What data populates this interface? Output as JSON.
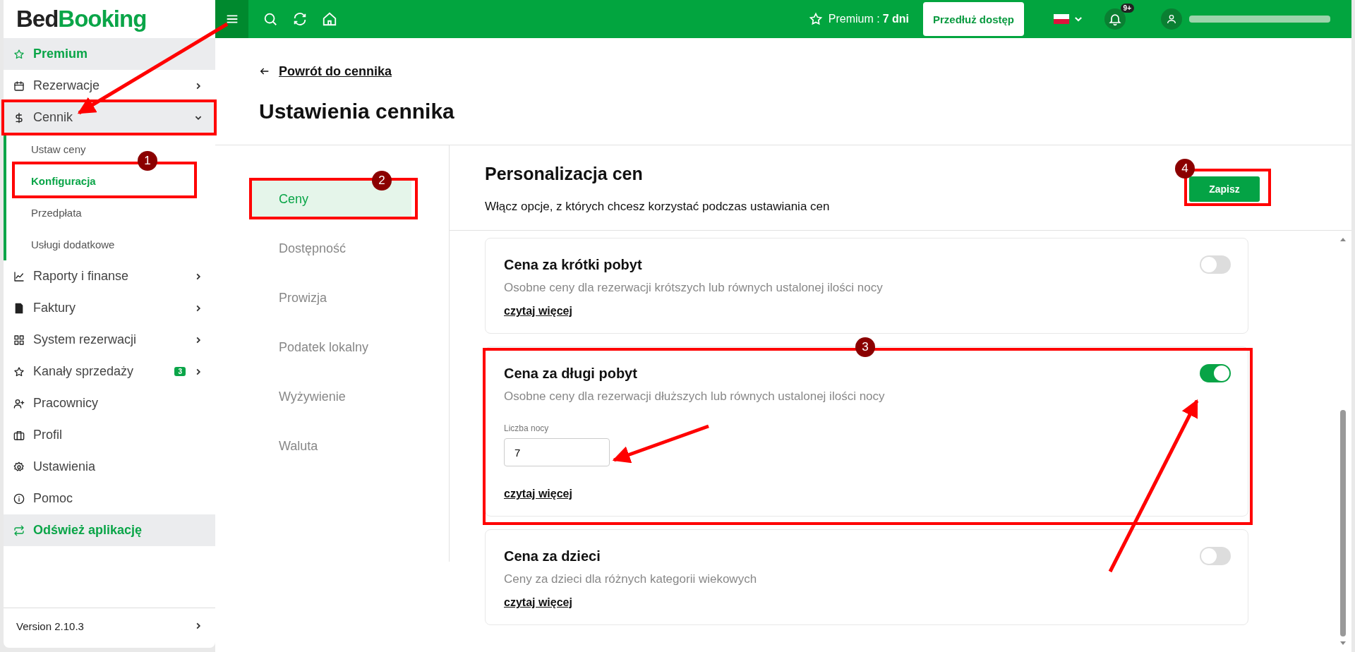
{
  "logo": {
    "part_1": "Bed",
    "part_2": "Booking"
  },
  "topbar": {
    "premium_label": "Premium :",
    "premium_days": "7 dni",
    "extend_button": "Przedłuż dostęp",
    "notification_badge": "9+"
  },
  "sidebar": {
    "items": [
      {
        "label": "Premium",
        "kind": "premium",
        "expandable": false
      },
      {
        "label": "Rezerwacje",
        "kind": "nav",
        "expandable": true,
        "expanded": false
      },
      {
        "label": "Cennik",
        "kind": "nav",
        "expandable": true,
        "expanded": true,
        "children": [
          {
            "label": "Ustaw ceny",
            "selected": false
          },
          {
            "label": "Konfiguracja",
            "selected": true
          },
          {
            "label": "Przedpłata",
            "selected": false
          },
          {
            "label": "Usługi dodatkowe",
            "selected": false
          }
        ]
      },
      {
        "label": "Raporty i finanse",
        "kind": "nav",
        "expandable": true,
        "expanded": false
      },
      {
        "label": "Faktury",
        "kind": "nav",
        "expandable": true,
        "expanded": false
      },
      {
        "label": "System rezerwacji",
        "kind": "nav",
        "expandable": true,
        "expanded": false
      },
      {
        "label": "Kanały sprzedaży",
        "kind": "nav",
        "expandable": true,
        "expanded": false,
        "badge": "3"
      },
      {
        "label": "Pracownicy",
        "kind": "nav",
        "expandable": false,
        "expanded": false
      },
      {
        "label": "Profil",
        "kind": "nav",
        "expandable": false,
        "expanded": false
      },
      {
        "label": "Ustawienia",
        "kind": "nav",
        "expandable": false,
        "expanded": false
      },
      {
        "label": "Pomoc",
        "kind": "nav",
        "expandable": false,
        "expanded": false
      },
      {
        "label": "Odśwież aplikację",
        "kind": "refresh",
        "expandable": false
      }
    ],
    "version": "Version 2.10.3"
  },
  "page": {
    "back_link": "Powrót do cennika",
    "title": "Ustawienia cennika"
  },
  "tabs": [
    {
      "label": "Ceny",
      "selected": true
    },
    {
      "label": "Dostępność",
      "selected": false
    },
    {
      "label": "Prowizja",
      "selected": false
    },
    {
      "label": "Podatek lokalny",
      "selected": false
    },
    {
      "label": "Wyżywienie",
      "selected": false
    },
    {
      "label": "Waluta",
      "selected": false
    }
  ],
  "section": {
    "title": "Personalizacja cen",
    "subtitle": "Włącz opcje, z których chcesz korzystać podczas ustawiania cen",
    "save_button": "Zapisz"
  },
  "options": [
    {
      "title": "Cena za krótki pobyt",
      "description": "Osobne ceny dla rezerwacji krótszych lub równych ustalonej ilości nocy",
      "on": false,
      "read_more": "czytaj więcej"
    },
    {
      "title": "Cena za długi pobyt",
      "description": "Osobne ceny dla rezerwacji dłuższych lub równych ustalonej ilości nocy",
      "on": true,
      "field": {
        "label": "Liczba nocy",
        "value": "7"
      },
      "read_more": "czytaj więcej"
    },
    {
      "title": "Cena za dzieci",
      "description": "Ceny za dzieci dla różnych kategorii wiekowych",
      "on": false,
      "read_more": "czytaj więcej"
    }
  ],
  "step_badges": [
    "1",
    "2",
    "3",
    "4"
  ]
}
